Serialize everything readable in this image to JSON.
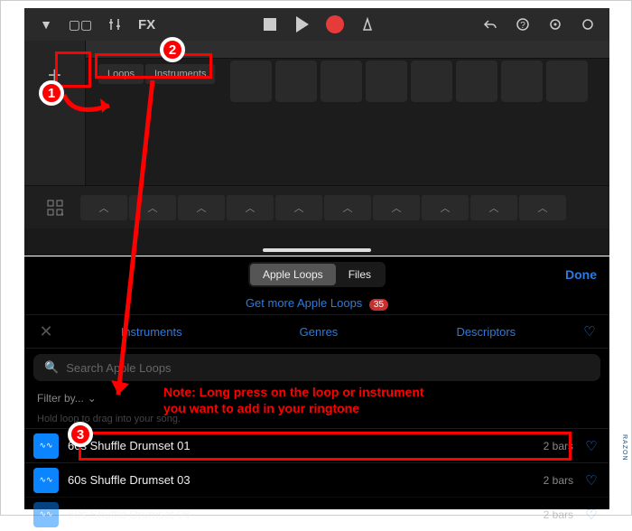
{
  "toolbar": {
    "fx_label": "FX"
  },
  "tabs": {
    "loops": "Loops",
    "instruments": "Instruments"
  },
  "browser": {
    "seg_loops": "Apple Loops",
    "seg_files": "Files",
    "done": "Done",
    "get_more": "Get more Apple Loops",
    "badge": "35",
    "cat_instruments": "Instruments",
    "cat_genres": "Genres",
    "cat_descriptors": "Descriptors",
    "search_placeholder": "Search Apple Loops",
    "filter_label": "Filter by...",
    "hold_hint": "Hold loop to drag into your song.",
    "loops": [
      {
        "name": "60s Shuffle Drumset 01",
        "bars": "2 bars"
      },
      {
        "name": "60s Shuffle Drumset 03",
        "bars": "2 bars"
      },
      {
        "name": "60s Shuffle Drumset 06",
        "bars": "2 bars"
      }
    ]
  },
  "annotations": {
    "n1": "1",
    "n2": "2",
    "n3": "3",
    "note_line1": "Note: Long press on the loop or instrument",
    "note_line2": "you want to add in your ringtone"
  }
}
